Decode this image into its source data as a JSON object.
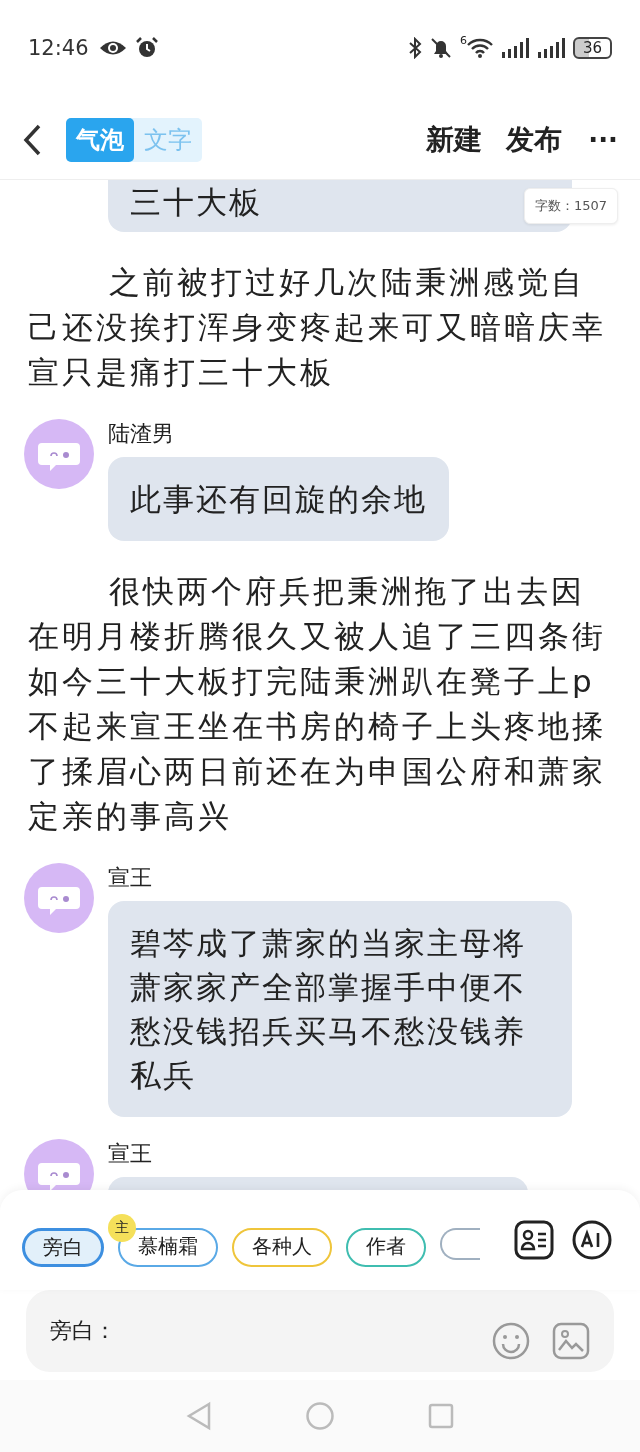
{
  "status_bar": {
    "time": "12:46",
    "wifi_badge": "6",
    "battery": "36"
  },
  "header": {
    "modes": [
      {
        "label": "气泡",
        "selected": true
      },
      {
        "label": "文字",
        "selected": false
      }
    ],
    "actions": [
      "新建",
      "发布"
    ],
    "more": "···"
  },
  "word_count": "字数：1507",
  "items": [
    {
      "kind": "bubble_cut",
      "text": "三十大板"
    },
    {
      "kind": "narration",
      "text": "之前被打过好几次陆秉洲感觉自己还没挨打浑身变疼起来可又暗暗庆幸宣只是痛打三十大板"
    },
    {
      "kind": "message",
      "name": "陆渣男",
      "text": "此事还有回旋的余地"
    },
    {
      "kind": "narration",
      "text": "很快两个府兵把秉洲拖了出去因在明月楼折腾很久又被人追了三四条街如今三十大板打完陆秉洲趴在凳子上p不起来宣王坐在书房的椅子上头疼地揉了揉眉心两日前还在为申国公府和萧家定亲的事高兴"
    },
    {
      "kind": "message",
      "name": "宣王",
      "text": "碧芩成了萧家的当家主母将萧家家产全部掌握手中便不愁没钱招兵买马不愁没钱养私兵"
    },
    {
      "kind": "message_cut",
      "name": "宣王"
    }
  ],
  "roles": [
    {
      "label": "旁白",
      "selected": true,
      "color": "#3d8fe0"
    },
    {
      "label": "慕楠霜",
      "selected": false,
      "color": "#5aa9e6",
      "badge": "主"
    },
    {
      "label": "各种人",
      "selected": false,
      "color": "#efc53b"
    },
    {
      "label": "作者",
      "selected": false,
      "color": "#3fbdb0"
    }
  ],
  "composer": {
    "prefix": "旁白："
  }
}
